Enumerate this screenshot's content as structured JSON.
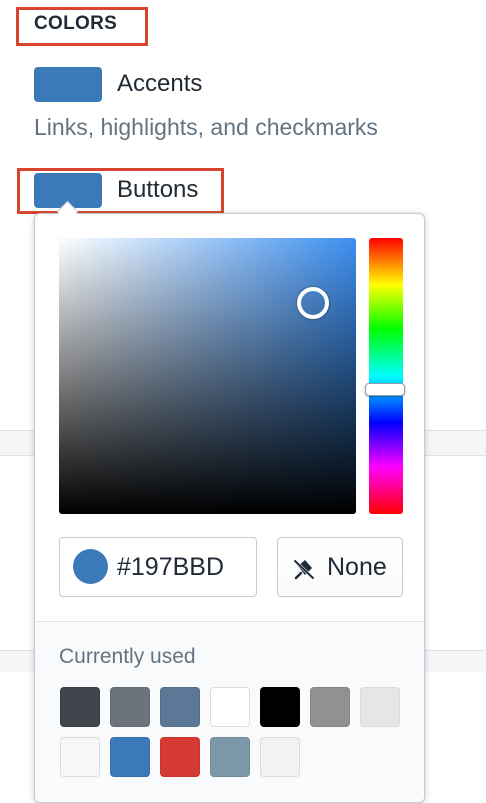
{
  "section": {
    "title": "COLORS"
  },
  "accents": {
    "label": "Accents",
    "color": "#3a7ab8",
    "description": "Links, highlights, and checkmarks"
  },
  "buttons": {
    "label": "Buttons",
    "color": "#3a7ab8"
  },
  "picker": {
    "hex_value": "#197BBD",
    "selected_color": "#3a7ab8",
    "hue_color": "#3d8ff0",
    "none_label": "None",
    "none_icon": "no-color-icon",
    "currently_used_label": "Currently used",
    "swatches": [
      "#40454c",
      "#6c737b",
      "#5b7896",
      "#ffffff",
      "#000000",
      "#919191",
      "#e5e6e8",
      "#f7f7f7",
      "#3a7ab8",
      "#d63b33",
      "#7c97a7",
      "#f3f3f3"
    ]
  }
}
